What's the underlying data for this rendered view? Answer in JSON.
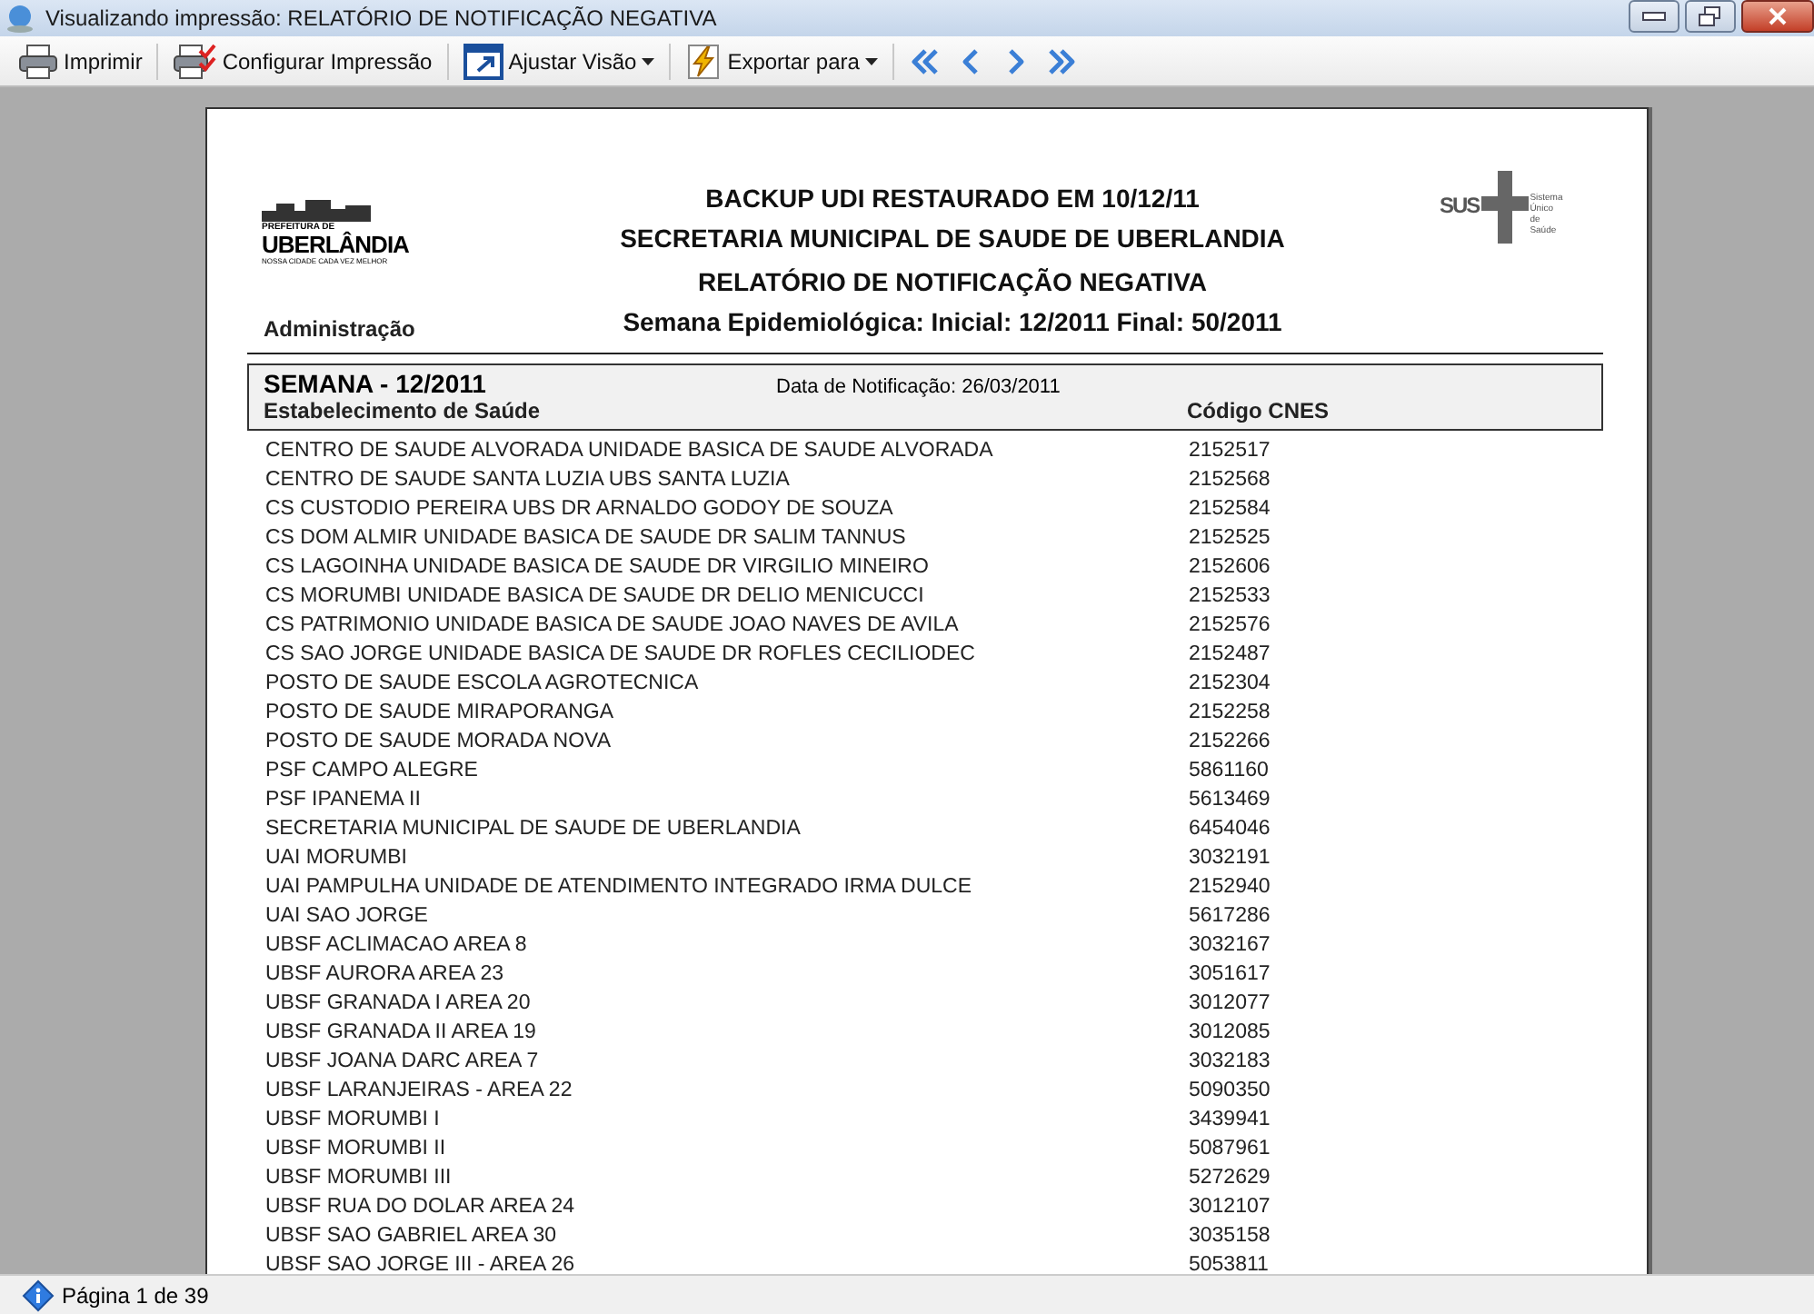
{
  "window": {
    "title": "Visualizando impressão: RELATÓRIO DE NOTIFICAÇÃO NEGATIVA"
  },
  "toolbar": [
    {
      "kind": "print",
      "label": "Imprimir"
    },
    {
      "kind": "setup",
      "label": "Configurar Impressão"
    },
    {
      "kind": "view",
      "label": "Ajustar Visão",
      "dropdown": true
    },
    {
      "kind": "export",
      "label": "Exportar para",
      "dropdown": true
    }
  ],
  "navigation": [
    {
      "kind": "first"
    },
    {
      "kind": "previous"
    },
    {
      "kind": "next"
    },
    {
      "kind": "last"
    }
  ],
  "report": {
    "logo_left": {
      "top": "PREFEITURA DE",
      "name": "UBERLÂNDIA",
      "motto": "NOSSA CIDADE CADA VEZ MELHOR"
    },
    "logo_right": {
      "name": "SUS",
      "sub": "Sistema Único de Saúde"
    },
    "titles": [
      "BACKUP UDI RESTAURADO EM 10/12/11",
      "SECRETARIA MUNICIPAL DE SAUDE DE UBERLANDIA",
      "RELATÓRIO DE NOTIFICAÇÃO NEGATIVA"
    ],
    "week_range": "Semana Epidemiológica: Inicial: 12/2011 Final: 50/2011",
    "department": "Administração",
    "section": {
      "week": "SEMANA - 12/2011",
      "notification_date": "Data de Notificação: 26/03/2011"
    },
    "columns": [
      "Estabelecimento de Saúde",
      "Código CNES"
    ],
    "rows": [
      [
        "CENTRO DE SAUDE ALVORADA UNIDADE BASICA DE SAUDE ALVORADA",
        "2152517"
      ],
      [
        "CENTRO DE SAUDE SANTA LUZIA UBS SANTA LUZIA",
        "2152568"
      ],
      [
        "CS CUSTODIO PEREIRA UBS DR ARNALDO GODOY DE SOUZA",
        "2152584"
      ],
      [
        "CS DOM ALMIR UNIDADE BASICA DE SAUDE DR SALIM TANNUS",
        "2152525"
      ],
      [
        "CS LAGOINHA UNIDADE BASICA DE SAUDE DR VIRGILIO MINEIRO",
        "2152606"
      ],
      [
        "CS MORUMBI UNIDADE BASICA DE SAUDE DR DELIO MENICUCCI",
        "2152533"
      ],
      [
        "CS PATRIMONIO UNIDADE BASICA DE SAUDE JOAO NAVES DE AVILA",
        "2152576"
      ],
      [
        "CS SAO JORGE UNIDADE BASICA DE SAUDE DR ROFLES CECILIODEC",
        "2152487"
      ],
      [
        "POSTO DE SAUDE ESCOLA AGROTECNICA",
        "2152304"
      ],
      [
        "POSTO DE SAUDE MIRAPORANGA",
        "2152258"
      ],
      [
        "POSTO DE SAUDE MORADA NOVA",
        "2152266"
      ],
      [
        "PSF CAMPO ALEGRE",
        "5861160"
      ],
      [
        "PSF IPANEMA II",
        "5613469"
      ],
      [
        "SECRETARIA MUNICIPAL DE SAUDE DE UBERLANDIA",
        "6454046"
      ],
      [
        "UAI MORUMBI",
        "3032191"
      ],
      [
        "UAI PAMPULHA UNIDADE DE ATENDIMENTO INTEGRADO IRMA DULCE",
        "2152940"
      ],
      [
        "UAI SAO JORGE",
        "5617286"
      ],
      [
        "UBSF ACLIMACAO AREA 8",
        "3032167"
      ],
      [
        "UBSF AURORA AREA 23",
        "3051617"
      ],
      [
        "UBSF GRANADA I AREA 20",
        "3012077"
      ],
      [
        "UBSF GRANADA II AREA 19",
        "3012085"
      ],
      [
        "UBSF JOANA DARC AREA 7",
        "3032183"
      ],
      [
        "UBSF LARANJEIRAS - AREA 22",
        "5090350"
      ],
      [
        "UBSF MORUMBI I",
        "3439941"
      ],
      [
        "UBSF MORUMBI II",
        "5087961"
      ],
      [
        "UBSF MORUMBI III",
        "5272629"
      ],
      [
        "UBSF RUA DO DOLAR AREA 24",
        "3012107"
      ],
      [
        "UBSF SAO GABRIEL AREA 30",
        "3035158"
      ],
      [
        "UBSF SAO JORGE III - AREA 26",
        "5053811"
      ]
    ]
  },
  "status_bar": {
    "page": "Página 1 de 39"
  }
}
